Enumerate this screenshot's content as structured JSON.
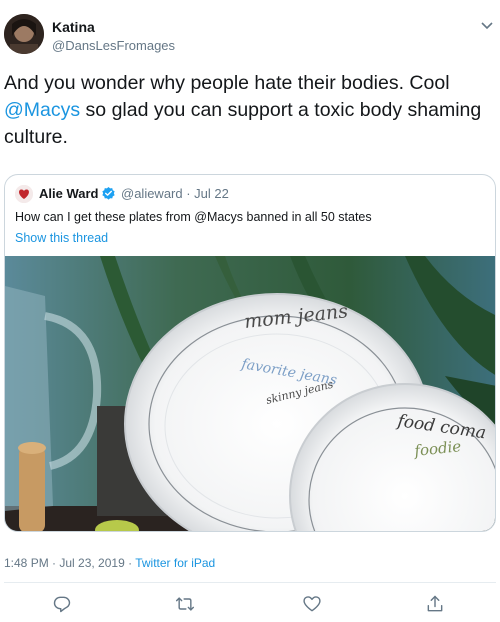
{
  "author": {
    "name": "Katina",
    "handle": "@DansLesFromages"
  },
  "tweet": {
    "text_before": "And you wonder why people hate their bodies. Cool ",
    "mention": "@Macys",
    "text_after": " so glad you can support a toxic body shaming culture."
  },
  "quoted": {
    "name": "Alie Ward",
    "handle": "@alieward · Jul 22",
    "text": "How can I get these plates from @Macys banned in all 50 states",
    "show_thread": "Show this thread",
    "image": {
      "plate1_line1": "mom jeans",
      "plate1_line2": "favorite jeans",
      "plate1_line3": "skinny jeans",
      "plate2_line1": "food coma",
      "plate2_line2": "foodie"
    }
  },
  "meta": {
    "timestamp": "1:48 PM · Jul 23, 2019 · ",
    "source": "Twitter for iPad"
  },
  "icons": {
    "reply": "reply-icon",
    "retweet": "retweet-icon",
    "like": "heart-icon",
    "share": "share-icon",
    "verified": "verified-badge-icon",
    "menu": "chevron-down-icon"
  },
  "colors": {
    "link": "#1b95e0",
    "secondary_text": "#657786",
    "border": "#ccd6dd",
    "verified": "#1da1f2"
  }
}
